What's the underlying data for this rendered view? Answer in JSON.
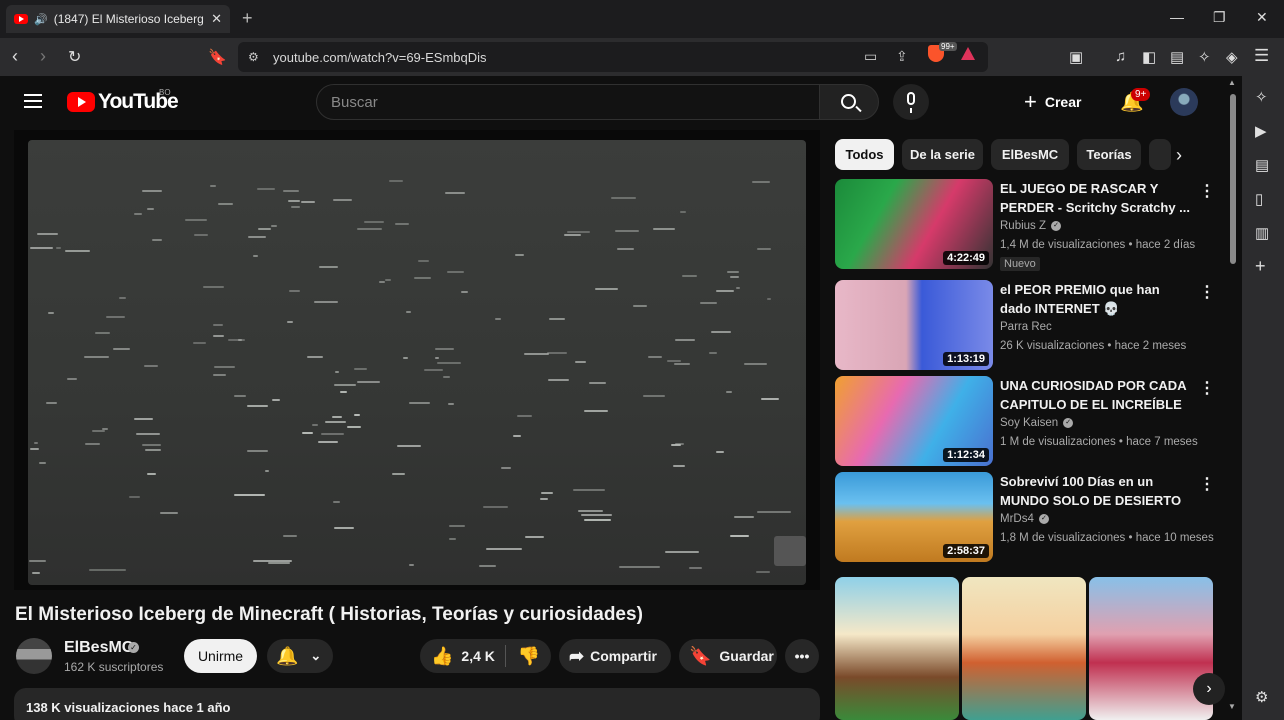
{
  "browser": {
    "tab_title": "(1847) El Misterioso Iceberg d",
    "url": "youtube.com/watch?v=69-ESmbqDis",
    "shields_badge": "99+"
  },
  "masthead": {
    "logo_text": "YouTube",
    "country_code": "BO",
    "search_placeholder": "Buscar",
    "create_label": "Crear",
    "notifications_badge": "9+"
  },
  "video": {
    "title": "El Misterioso Iceberg de Minecraft ( Historias, Teorías y curiosidades)",
    "channel": "ElBesMC",
    "subscribers": "162 K suscriptores",
    "join_label": "Unirme",
    "likes": "2,4 K",
    "share_label": "Compartir",
    "save_label": "Guardar",
    "stats": "138 K visualizaciones  hace 1 año"
  },
  "chips": [
    "Todos",
    "De la serie",
    "ElBesMC",
    "Teorías"
  ],
  "recommended": [
    {
      "title": "EL JUEGO DE RASCAR Y PERDER - Scritchy Scratchy ...",
      "channel": "Rubius Z",
      "meta": "1,4 M de visualizaciones • hace 2 días",
      "duration": "4:22:49",
      "badge": "Nuevo"
    },
    {
      "title": "el PEOR PREMIO que han dado INTERNET 💀",
      "channel": "Parra Rec",
      "meta": "26 K visualizaciones • hace 2 meses",
      "duration": "1:13:19",
      "badge": ""
    },
    {
      "title": "UNA CURIOSIDAD POR CADA CAPITULO DE EL INCREÍBLE ...",
      "channel": "Soy Kaisen",
      "meta": "1 M de visualizaciones • hace 7 meses",
      "duration": "1:12:34",
      "badge": ""
    },
    {
      "title": "Sobreviví 100 Días en un MUNDO SOLO DE DESIERTO e...",
      "channel": "MrDs4",
      "meta": "1,8 M de visualizaciones • hace 10 meses",
      "duration": "2:58:37",
      "badge": ""
    }
  ],
  "colors": {
    "accent": "#ff0000",
    "background": "#0f0f0f",
    "chip_bg": "#272727"
  }
}
